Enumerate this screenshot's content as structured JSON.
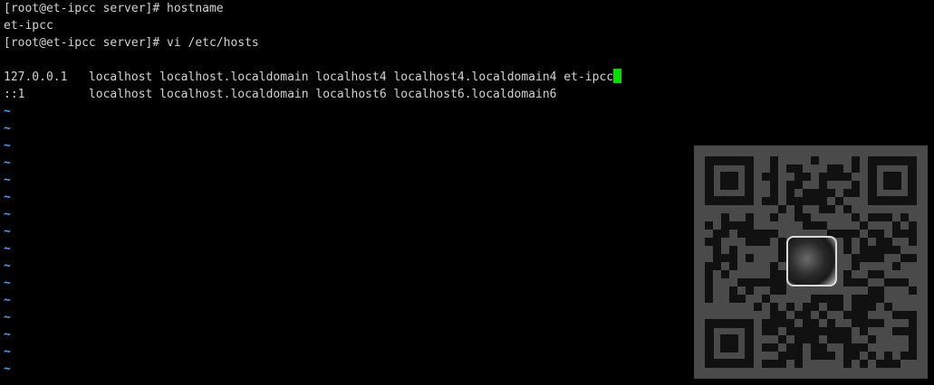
{
  "terminal": {
    "lines": [
      "[root@et-ipcc server]# hostname",
      "et-ipcc",
      "[root@et-ipcc server]# vi /etc/hosts",
      "",
      "127.0.0.1   localhost localhost.localdomain localhost4 localhost4.localdomain4 et-ipcc",
      "::1         localhost localhost.localdomain localhost6 localhost6.localdomain6"
    ],
    "tilde": "~",
    "tilde_count": 16
  },
  "colors": {
    "background": "#000000",
    "text": "#d2d2d2",
    "tilde": "#4aa3ff",
    "cursor": "#00e000",
    "qr_background": "#4a4a4a"
  }
}
